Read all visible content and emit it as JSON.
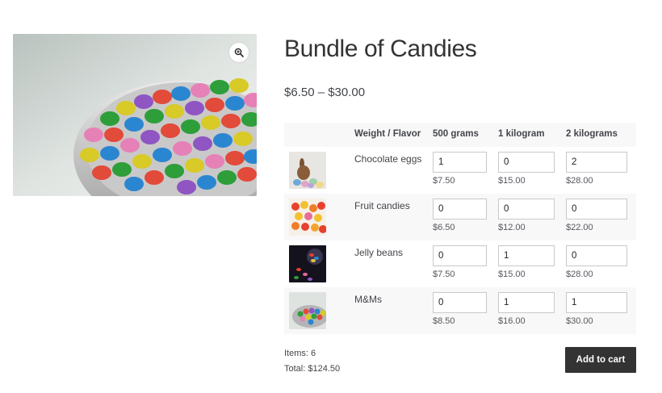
{
  "product": {
    "title": "Bundle of Candies",
    "price_range": "$6.50 – $30.00",
    "zoom_icon": "zoom-in-icon"
  },
  "table": {
    "headers": [
      "",
      "Weight / Flavor",
      "500 grams",
      "1 kilogram",
      "2 kilograms"
    ],
    "rows": [
      {
        "flavor": "Chocolate eggs",
        "thumb": "chocolate-eggs-thumbnail",
        "quantities": [
          "1",
          "0",
          "2"
        ],
        "prices": [
          "$7.50",
          "$15.00",
          "$28.00"
        ]
      },
      {
        "flavor": "Fruit candies",
        "thumb": "fruit-candies-thumbnail",
        "quantities": [
          "0",
          "0",
          "0"
        ],
        "prices": [
          "$6.50",
          "$12.00",
          "$22.00"
        ]
      },
      {
        "flavor": "Jelly beans",
        "thumb": "jelly-beans-thumbnail",
        "quantities": [
          "0",
          "1",
          "0"
        ],
        "prices": [
          "$7.50",
          "$15.00",
          "$28.00"
        ]
      },
      {
        "flavor": "M&Ms",
        "thumb": "mms-thumbnail",
        "quantities": [
          "0",
          "1",
          "1"
        ],
        "prices": [
          "$8.50",
          "$16.00",
          "$30.00"
        ]
      }
    ]
  },
  "summary": {
    "items": "Items: 6",
    "total": "Total: $124.50"
  },
  "cart": {
    "button_label": "Add to cart"
  },
  "colors": {
    "button_bg": "#333333",
    "row_alt_bg": "#f8f8f8",
    "text": "#43454b"
  }
}
